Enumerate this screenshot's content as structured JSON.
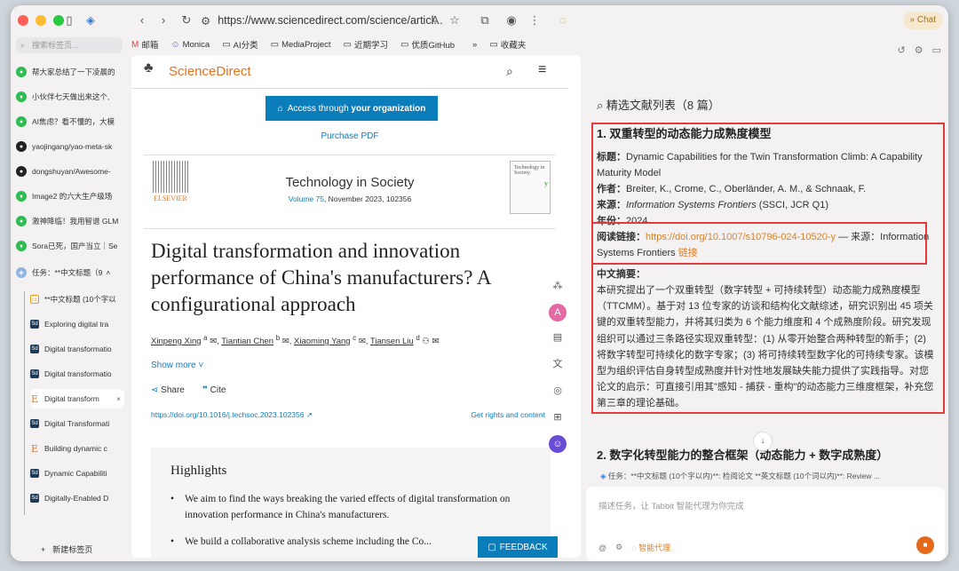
{
  "browser": {
    "url": "https://www.sciencedirect.com/science/articl...",
    "chat_label": "Chat"
  },
  "bookmarks": [
    {
      "icon": "gmail-icon",
      "label": "邮箱"
    },
    {
      "icon": "monica-icon",
      "label": "Monica"
    },
    {
      "icon": "folder-icon",
      "label": "AI分类"
    },
    {
      "icon": "folder-icon",
      "label": "MediaProject"
    },
    {
      "icon": "folder-icon",
      "label": "近期学习"
    },
    {
      "icon": "folder-icon",
      "label": "优质GitHub"
    },
    {
      "icon": "folder-icon",
      "label": "收藏夹"
    }
  ],
  "sidebar": {
    "search_placeholder": "搜索标签页...",
    "tabs": [
      {
        "icon": "wechat",
        "label": "帮大家总结了一下凌晨的"
      },
      {
        "icon": "wechat",
        "label": "小伙伴七天做出来这个,"
      },
      {
        "icon": "wechat",
        "label": "AI焦虑？看不懂的，大模"
      },
      {
        "icon": "github",
        "label": "yaojingang/yao-meta-sk"
      },
      {
        "icon": "github",
        "label": "dongshuyan/Awesome-"
      },
      {
        "icon": "wechat",
        "label": "Image2 的六大生产级场"
      },
      {
        "icon": "wechat",
        "label": "激神降临！我用智谱 GLM"
      },
      {
        "icon": "wechat",
        "label": "Sora已死，国产当立｜Se"
      }
    ],
    "task_group": "任务：**中文标题（9",
    "subtabs": [
      {
        "icon": "chat",
        "label": "**中文标题 (10个字以"
      },
      {
        "icon": "sd",
        "label": "Exploring digital tra"
      },
      {
        "icon": "sd",
        "label": "Digital transformatio"
      },
      {
        "icon": "sd",
        "label": "Digital transformatio"
      },
      {
        "icon": "e",
        "label": "Digital transform"
      },
      {
        "icon": "sd",
        "label": "Digital Transformati"
      },
      {
        "icon": "e",
        "label": "Building dynamic c"
      },
      {
        "icon": "sd",
        "label": "Dynamic Capabiliti"
      },
      {
        "icon": "sd",
        "label": "Digitally-Enabled D"
      }
    ],
    "new_tab": "新建标签页"
  },
  "article": {
    "site_logo": "ScienceDirect",
    "access_prefix": "Access through ",
    "access_bold": "your organization",
    "purchase": "Purchase PDF",
    "publisher": "ELSEVIER",
    "journal": "Technology in Society",
    "volume_link": "Volume 75",
    "volume_rest": ", November 2023, 102356",
    "cover_text": "Technology in Society",
    "title": "Digital transformation and innovation performance of China's manufacturers? A configurational approach",
    "authors": [
      {
        "name": "Xinpeng Xing",
        "sup": "a"
      },
      {
        "name": "Tiantian Chen",
        "sup": "b"
      },
      {
        "name": "Xiaoming Yang",
        "sup": "c"
      },
      {
        "name": "Tiansen Liu",
        "sup": "d"
      }
    ],
    "show_more": "Show more",
    "share": "Share",
    "cite": "Cite",
    "doi": "https://doi.org/10.1016/j.techsoc.2023.102356",
    "rights": "Get rights and content",
    "highlights_title": "Highlights",
    "highlights": [
      "We aim to find the ways breaking the varied effects of digital transformation on innovation performance in China's manufacturers.",
      "We build a collaborative analysis scheme including the Co..."
    ],
    "feedback": "FEEDBACK"
  },
  "panel": {
    "list_title": "精选文献列表（8 篇）",
    "item1": {
      "heading": "1. 双重转型的动态能力成熟度模型",
      "title_label": "标题：",
      "title_value": "Dynamic Capabilities for the Twin Transformation Climb: A Capability Maturity Model",
      "author_label": "作者：",
      "author_value": "Breiter, K., Crome, C., Oberländer, A. M., & Schnaak, F.",
      "source_label": "来源：",
      "source_value": "Information Systems Frontiers",
      "source_extra": " (SSCI, JCR Q1)",
      "year_label": "年份：",
      "year_value": "2024",
      "link_label": "阅读链接：",
      "link_url": "https://doi.org/10.1007/s10796-024-10520-y",
      "link_source": " — 来源：Information Systems Frontiers ",
      "link_word": "链接",
      "abstract_label": "中文摘要：",
      "abstract": "本研究提出了一个双重转型（数字转型 + 可持续转型）动态能力成熟度模型（TTCMM）。基于对 13 位专家的访谈和结构化文献综述，研究识别出 45 项关键的双重转型能力，并将其归类为 6 个能力维度和 4 个成熟度阶段。研究发现组织可以通过三条路径实现双重转型：(1) 从零开始整合两种转型的新手；(2) 将数字转型可持续化的数字专家；(3) 将可持续转型数字化的可持续专家。该模型为组织评估自身转型成熟度并针对性地发展缺失能力提供了实践指导。对您论文的启示：可直接引用其\"感知 - 捕获 - 重构\"的动态能力三维度框架，补充您第三章的理论基础。"
    },
    "item2_heading": "2. 数字化转型能力的整合框架（动态能力 + 数字成熟度）",
    "task_bar": "任务：**中文标题 (10个字以内)**: 检阅论文 **英文标题 (10个词以内)**: Review ...",
    "input_placeholder": "描述任务，让 Tabbit 智能代理为你完成",
    "agent_label": "智能代理"
  }
}
